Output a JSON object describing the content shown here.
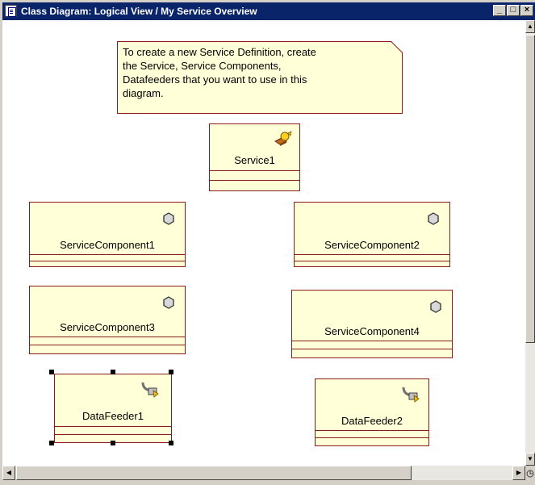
{
  "window": {
    "title": "Class Diagram: Logical View / My Service Overview",
    "buttons": {
      "minimize": "_",
      "maximize": "□",
      "close": "×"
    }
  },
  "note": {
    "lines": [
      "To create a new Service Definition, create",
      "the Service, Service Components,",
      "Datafeeders that you want to use in this",
      "diagram."
    ]
  },
  "classes": {
    "service1": {
      "name": "Service1",
      "icon": "service-icon"
    },
    "component1": {
      "name": "ServiceComponent1",
      "icon": "component-icon"
    },
    "component2": {
      "name": "ServiceComponent2",
      "icon": "component-icon"
    },
    "component3": {
      "name": "ServiceComponent3",
      "icon": "component-icon"
    },
    "component4": {
      "name": "ServiceComponent4",
      "icon": "component-icon"
    },
    "datafeeder1": {
      "name": "DataFeeder1",
      "icon": "datafeeder-icon",
      "selected": true
    },
    "datafeeder2": {
      "name": "DataFeeder2",
      "icon": "datafeeder-icon"
    }
  },
  "scrollbars": {
    "up": "▲",
    "down": "▼",
    "left": "◀",
    "right": "▶"
  },
  "colors": {
    "titlebar": "#0a246a",
    "class_fill": "#ffffd8",
    "class_border": "#8b1a1a"
  }
}
